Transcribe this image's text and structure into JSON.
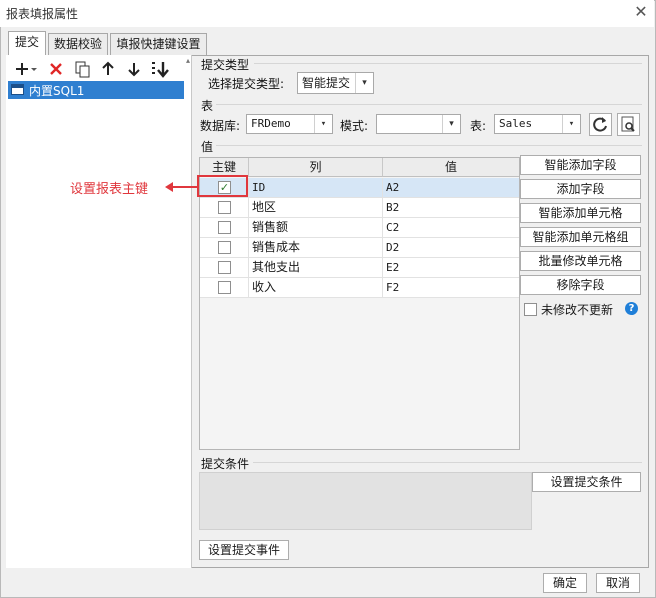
{
  "window": {
    "title": "报表填报属性",
    "close_glyph": "✕"
  },
  "tabs": [
    {
      "label": "提交",
      "active": true
    },
    {
      "label": "数据校验",
      "active": false
    },
    {
      "label": "填报快捷键设置",
      "active": false
    }
  ],
  "toolbar": {
    "icons": [
      "add-dropdown-icon",
      "delete-icon",
      "copy-icon",
      "move-up-icon",
      "move-down-icon",
      "sort-icon"
    ]
  },
  "tree": {
    "items": [
      {
        "label": "内置SQL1"
      }
    ]
  },
  "submit_type": {
    "section_title": "提交类型",
    "label": "选择提交类型:",
    "value": "智能提交"
  },
  "table": {
    "section_title": "表",
    "db_label": "数据库:",
    "db_value": "FRDemo",
    "mode_label": "模式:",
    "mode_value": "",
    "table_label": "表:",
    "table_value": "Sales"
  },
  "values": {
    "section_title": "值",
    "columns": [
      "主键",
      "列",
      "值"
    ],
    "rows": [
      {
        "key": true,
        "column": "ID",
        "value": "A2"
      },
      {
        "key": false,
        "column": "地区",
        "value": "B2"
      },
      {
        "key": false,
        "column": "销售额",
        "value": "C2"
      },
      {
        "key": false,
        "column": "销售成本",
        "value": "D2"
      },
      {
        "key": false,
        "column": "其他支出",
        "value": "E2"
      },
      {
        "key": false,
        "column": "收入",
        "value": "F2"
      }
    ],
    "buttons": [
      "智能添加字段",
      "添加字段",
      "智能添加单元格",
      "智能添加单元格组",
      "批量修改单元格",
      "移除字段"
    ],
    "no_update_label": "未修改不更新"
  },
  "annotation": {
    "text": "设置报表主键",
    "color": "#e0373d"
  },
  "condition": {
    "section_title": "提交条件",
    "button": "设置提交条件"
  },
  "event_button": "设置提交事件",
  "footer": {
    "ok": "确定",
    "cancel": "取消"
  },
  "colors": {
    "selection": "#2f7fd0",
    "accent_red": "#e0373d",
    "help_blue": "#1f7fd8"
  }
}
